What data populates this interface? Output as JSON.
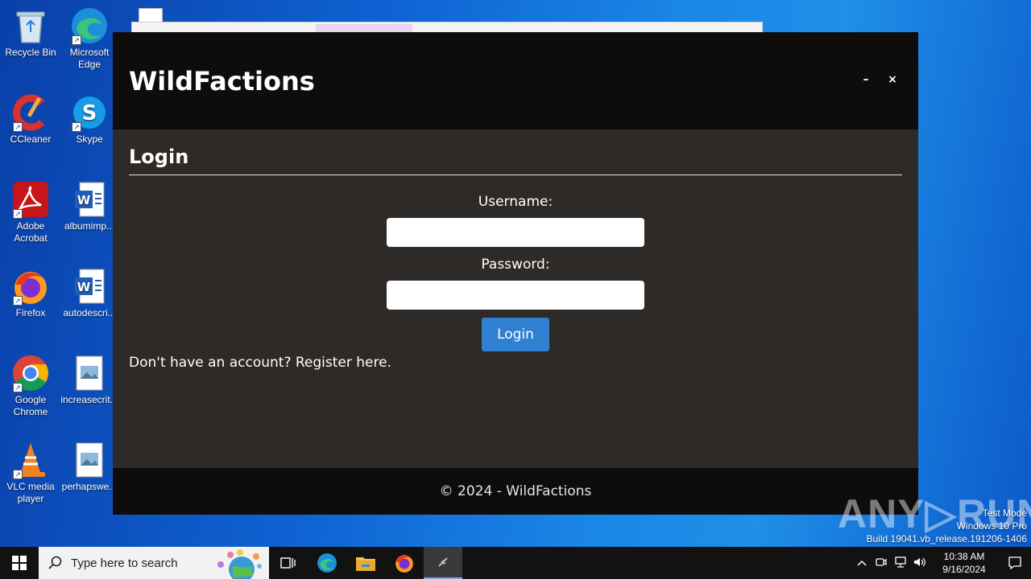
{
  "desktop": {
    "icons": [
      {
        "label": "Recycle Bin",
        "label2": ""
      },
      {
        "label": "Microsoft",
        "label2": "Edge"
      },
      {
        "label": "CCleaner",
        "label2": ""
      },
      {
        "label": "Skype",
        "label2": ""
      },
      {
        "label": "Adobe",
        "label2": "Acrobat"
      },
      {
        "label": "albumimp...",
        "label2": ""
      },
      {
        "label": "Firefox",
        "label2": ""
      },
      {
        "label": "autodescri...",
        "label2": ""
      },
      {
        "label": "Google",
        "label2": "Chrome"
      },
      {
        "label": "increasecrit...",
        "label2": ""
      },
      {
        "label": "VLC media",
        "label2": "player"
      },
      {
        "label": "perhapswe...",
        "label2": ""
      }
    ]
  },
  "app": {
    "title": "WildFactions",
    "minimize_glyph": "–",
    "close_glyph": "×",
    "section_title": "Login",
    "username_label": "Username:",
    "username_value": "",
    "password_label": "Password:",
    "password_value": "",
    "login_button": "Login",
    "register_text": "Don't have an account? Register here.",
    "footer": "© 2024 - WildFactions"
  },
  "watermark": {
    "text": "ANY▷RUN",
    "mode": "Test Mode",
    "os": "Windows 10 Pro",
    "build": "Build 19041.vb_release.191206-1406"
  },
  "taskbar": {
    "search_placeholder": "Type here to search",
    "time": "10:38 AM",
    "date": "9/16/2024"
  },
  "colors": {
    "header_bg": "#0f0d0c",
    "body_bg": "#2d2a28",
    "button_bg": "#2f80d1"
  }
}
